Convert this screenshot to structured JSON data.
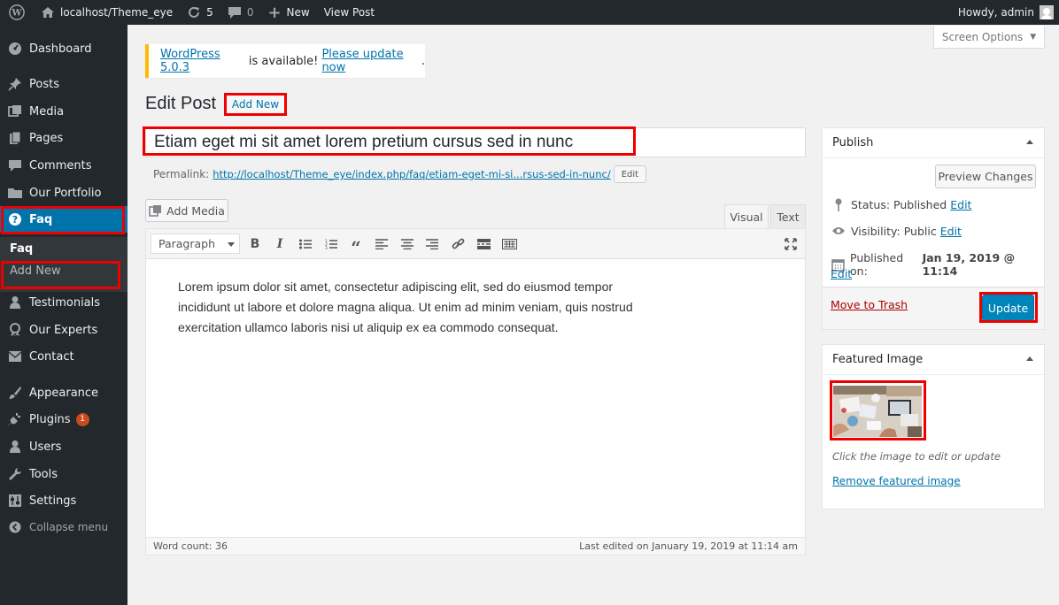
{
  "adminbar": {
    "site_name": "localhost/Theme_eye",
    "updates_count": "5",
    "comments_count": "0",
    "new_label": "New",
    "view_post_label": "View Post",
    "howdy": "Howdy, admin"
  },
  "sidebar": {
    "items": [
      {
        "label": "Dashboard",
        "icon": "dashboard-icon"
      },
      {
        "label": "Posts",
        "icon": "pin-icon"
      },
      {
        "label": "Media",
        "icon": "media-icon"
      },
      {
        "label": "Pages",
        "icon": "pages-icon"
      },
      {
        "label": "Comments",
        "icon": "comments-icon"
      },
      {
        "label": "Our Portfolio",
        "icon": "folder-icon"
      },
      {
        "label": "Faq",
        "icon": "question-icon"
      },
      {
        "label": "Testimonials",
        "icon": "person-icon"
      },
      {
        "label": "Our Experts",
        "icon": "award-icon"
      },
      {
        "label": "Contact",
        "icon": "mail-icon"
      },
      {
        "label": "Appearance",
        "icon": "brush-icon"
      },
      {
        "label": "Plugins",
        "icon": "plug-icon",
        "badge": "1"
      },
      {
        "label": "Users",
        "icon": "users-icon"
      },
      {
        "label": "Tools",
        "icon": "wrench-icon"
      },
      {
        "label": "Settings",
        "icon": "sliders-icon"
      },
      {
        "label": "Collapse menu",
        "icon": "collapse-icon"
      }
    ],
    "submenu": {
      "current": "Faq",
      "add_new": "Add New"
    }
  },
  "notice": {
    "version_link": "WordPress 5.0.3",
    "middle_text": " is available! ",
    "update_link": "Please update now",
    "end_text": "."
  },
  "screen_options": "Screen Options",
  "page": {
    "title": "Edit Post",
    "add_new": "Add New"
  },
  "post": {
    "title": "Etiam eget mi sit amet lorem pretium cursus sed in nunc",
    "permalink_label": "Permalink:",
    "permalink_url": "http://localhost/Theme_eye/index.php/faq/etiam-eget-mi-si...rsus-sed-in-nunc/",
    "permalink_edit": "Edit",
    "body": "Lorem ipsum dolor sit amet, consectetur adipiscing elit, sed do eiusmod tempor incididunt ut labore et dolore magna aliqua. Ut enim ad minim veniam, quis nostrud exercitation ullamco laboris nisi ut aliquip ex ea commodo consequat."
  },
  "editor": {
    "add_media": "Add Media",
    "tab_visual": "Visual",
    "tab_text": "Text",
    "format": "Paragraph",
    "word_count": "Word count: 36",
    "last_edited": "Last edited on January 19, 2019 at 11:14 am"
  },
  "publish": {
    "heading": "Publish",
    "preview": "Preview Changes",
    "status_label": "Status:",
    "status_value": "Published",
    "visibility_label": "Visibility:",
    "visibility_value": "Public",
    "published_label": "Published on:",
    "published_value": "Jan 19, 2019 @ 11:14",
    "edit": "Edit",
    "trash": "Move to Trash",
    "update": "Update"
  },
  "featured": {
    "heading": "Featured Image",
    "hint": "Click the image to edit or update",
    "remove": "Remove featured image"
  },
  "colors": {
    "accent": "#0073aa",
    "highlight": "#ee0000",
    "sidebar": "#23282d"
  }
}
